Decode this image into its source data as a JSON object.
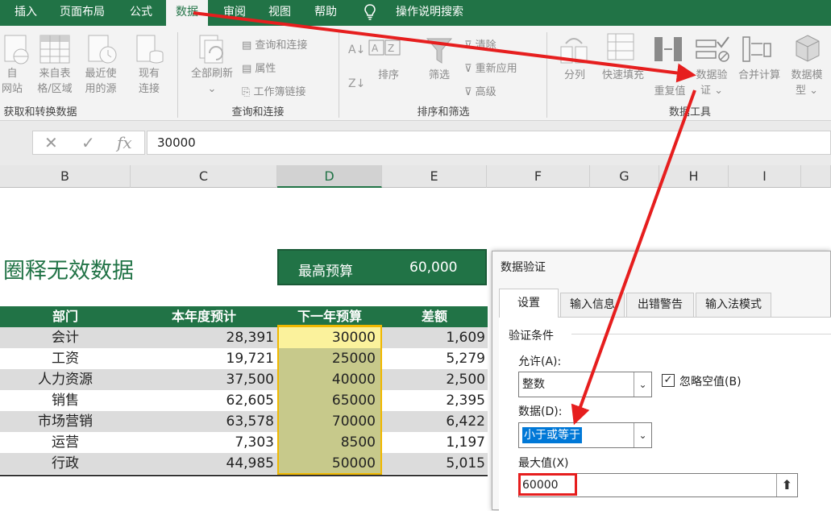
{
  "ribbon_tabs": [
    {
      "label": "插入"
    },
    {
      "label": "页面布局"
    },
    {
      "label": "公式"
    },
    {
      "label": "数据"
    },
    {
      "label": "审阅"
    },
    {
      "label": "视图"
    },
    {
      "label": "帮助"
    },
    {
      "label": "操作说明搜索"
    }
  ],
  "ribbon": {
    "get_data": {
      "btn1": {
        "line1": "自",
        "line2": "网站"
      },
      "btn2": {
        "line1": "来自表",
        "line2": "格/区域"
      },
      "btn3": {
        "line1": "最近使",
        "line2": "用的源"
      },
      "btn4": {
        "line1": "现有",
        "line2": "连接"
      },
      "group": "获取和转换数据"
    },
    "queries": {
      "refresh": {
        "line1": "全部刷新",
        "line2": "⌄"
      },
      "items": [
        "查询和连接",
        "属性",
        "工作簿链接"
      ],
      "group": "查询和连接"
    },
    "sort": {
      "sort": "排序",
      "filter": "筛选",
      "items": [
        "清除",
        "重新应用",
        "高级"
      ],
      "group": "排序和筛选"
    },
    "tools": {
      "split": "分列",
      "flash": "快速填充",
      "dup": "重复值",
      "validation": {
        "line1": "数据验",
        "line2": "证 ⌄"
      },
      "consolidate": "合并计算",
      "model": {
        "line1": "数据模",
        "line2": "型 ⌄"
      },
      "group": "数据工具"
    }
  },
  "formula_bar": {
    "cancel": "✕",
    "enter": "✓",
    "fx": "fx",
    "value": "30000"
  },
  "columns": [
    "B",
    "C",
    "D",
    "E",
    "F",
    "G",
    "H",
    "I"
  ],
  "sheet": {
    "title": "圈释无效数据",
    "max_label": "最高预算",
    "max_value": "60,000",
    "headers": [
      "部门",
      "本年度预计",
      "下一年预算",
      "差额"
    ],
    "rows": [
      {
        "dept": "会计",
        "current": "28,391",
        "next": "30000",
        "diff": "1,609"
      },
      {
        "dept": "工资",
        "current": "19,721",
        "next": "25000",
        "diff": "5,279"
      },
      {
        "dept": "人力资源",
        "current": "37,500",
        "next": "40000",
        "diff": "2,500"
      },
      {
        "dept": "销售",
        "current": "62,605",
        "next": "65000",
        "diff": "2,395"
      },
      {
        "dept": "市场营销",
        "current": "63,578",
        "next": "70000",
        "diff": "6,422"
      },
      {
        "dept": "运营",
        "current": "7,303",
        "next": "8500",
        "diff": "1,197"
      },
      {
        "dept": "行政",
        "current": "44,985",
        "next": "50000",
        "diff": "5,015"
      }
    ]
  },
  "dialog": {
    "title": "数据验证",
    "tabs": [
      "设置",
      "输入信息",
      "出错警告",
      "输入法模式"
    ],
    "section": "验证条件",
    "allow_label": "允许(A):",
    "allow_value": "整数",
    "ignore_blank": "忽略空值(B)",
    "data_label": "数据(D):",
    "data_value": "小于或等于",
    "max_label": "最大值(X)",
    "max_value": "60000",
    "collapse_icon": "⬆"
  },
  "colors": {
    "accent": "#217346",
    "annotation": "#e61e1e",
    "highlight": "#fbf29c",
    "column_fill": "#c7c98b"
  }
}
